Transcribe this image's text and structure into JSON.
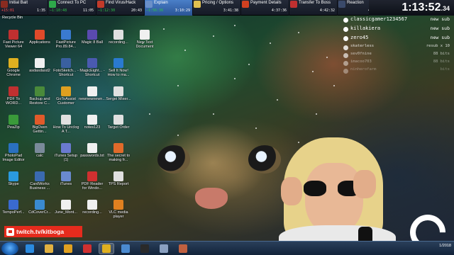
{
  "splits": [
    {
      "name": "Initial Bait",
      "delta": "+15:01",
      "delta_color": "#ff4d4d",
      "time": "1:35",
      "icon_color": "#8a2b20"
    },
    {
      "name": "Connect To PC",
      "delta": "—1:10:48",
      "delta_color": "#2ec24a",
      "time": "11:05",
      "icon_color": "#2ea84a"
    },
    {
      "name": "Find Virus/Hack",
      "delta": "—1:12:30",
      "delta_color": "#2ec24a",
      "time": "20:43",
      "icon_color": "#c23a2a"
    },
    {
      "name": "Explain",
      "delta": "—1:56:36",
      "delta_color": "#2ec24a",
      "time": "3:10:29",
      "icon_color": "#6a8fc8",
      "current": true
    },
    {
      "name": "Pricing / Options",
      "delta": "",
      "delta_color": "#ffffff",
      "time": "3:41:38",
      "icon_color": "#e0c050"
    },
    {
      "name": "Payment Details",
      "delta": "",
      "delta_color": "#ffffff",
      "time": "4:37:36",
      "icon_color": "#d04020"
    },
    {
      "name": "Transfer To Boss",
      "delta": "",
      "delta_color": "#ffffff",
      "time": "4:42:32",
      "icon_color": "#c03030"
    },
    {
      "name": "Reaction",
      "delta": "",
      "delta_color": "#ffffff",
      "time": "4:52:04",
      "icon_color": "#3a4a6a"
    }
  ],
  "timer": {
    "main": "1:13:52",
    "fraction": ".34"
  },
  "desktop": {
    "recycle_bin": "Recycle Bin",
    "icons": [
      {
        "label": "Fast Picture Viewer 64",
        "color": "#c03030"
      },
      {
        "label": "Applications",
        "color": "#e04a2a"
      },
      {
        "label": "FastPicture Pro.89.84...",
        "color": "#3a7ad0"
      },
      {
        "label": "Magic 8 Ball",
        "color": "#5a4ab0"
      },
      {
        "label": "recording...",
        "color": "#e0e0e0"
      },
      {
        "label": "New Text Document",
        "color": "#f0f0f0"
      },
      {
        "label": "Google Chrome",
        "color": "#e0b020"
      },
      {
        "label": "asdasdasd2",
        "color": "#f0f0f0"
      },
      {
        "label": "FotoSketch... - Shortcut",
        "color": "#3a60a0"
      },
      {
        "label": "MagicEight... - Shortcut",
        "color": "#4a5ab0"
      },
      {
        "label": "Sell It Now! How to ma...",
        "color": "#2a7ad0"
      },
      {
        "label": "",
        "color": "transparent"
      },
      {
        "label": "PDF To WORD...",
        "color": "#c03030"
      },
      {
        "label": "Backup and Restore C...",
        "color": "#4a8a3a"
      },
      {
        "label": "GoToAssist Customer",
        "color": "#e0a020"
      },
      {
        "label": "newnewnewn...",
        "color": "#f0f0f0"
      },
      {
        "label": "Sergei Mixer...",
        "color": "#e0e0e0"
      },
      {
        "label": "",
        "color": "transparent"
      },
      {
        "label": "PeaZip",
        "color": "#3a9a3a"
      },
      {
        "label": "BigOven Gettin...",
        "color": "#e05a2a"
      },
      {
        "label": "How To Unclog A T...",
        "color": "#e0e0e0"
      },
      {
        "label": "notes123",
        "color": "#f0f0f0"
      },
      {
        "label": "Target Order",
        "color": "#e0e0e0"
      },
      {
        "label": "",
        "color": "transparent"
      },
      {
        "label": "PhotoPad Image Editor",
        "color": "#2a70c0"
      },
      {
        "label": "calc",
        "color": "#7a8a9a"
      },
      {
        "label": "iTunes Setup (1)",
        "color": "#6a7ad0"
      },
      {
        "label": "passwords.txt",
        "color": "#f0f0f0"
      },
      {
        "label": "The secret to making fr...",
        "color": "#e06a2a"
      },
      {
        "label": "",
        "color": "transparent"
      },
      {
        "label": "Skype",
        "color": "#2a9ae0"
      },
      {
        "label": "CardWorks Business ...",
        "color": "#3a6ab0"
      },
      {
        "label": "iTunes",
        "color": "#6a8ad0"
      },
      {
        "label": "PDF Reader for Windo...",
        "color": "#d03030"
      },
      {
        "label": "TPS Report",
        "color": "#e0e0e0"
      },
      {
        "label": "",
        "color": "transparent"
      },
      {
        "label": "TempoPerf...",
        "color": "#3a6ad0"
      },
      {
        "label": "CdCoverCr...",
        "color": "#3a8ad0"
      },
      {
        "label": "June_Mont...",
        "color": "#f0f0f0"
      },
      {
        "label": "recording...",
        "color": "#f0f0f0"
      },
      {
        "label": "VLC media player",
        "color": "#e08020"
      }
    ]
  },
  "chat": [
    {
      "user": "classicgamer1234567",
      "event": "new sub"
    },
    {
      "user": "killakiera",
      "event": "new sub"
    },
    {
      "user": "zero45",
      "event": "new sub"
    },
    {
      "user": "skaterless",
      "event": "resub x 10",
      "small": true
    },
    {
      "user": "sev0fnine",
      "event": "88 bits",
      "small": true
    },
    {
      "user": "imacoo703",
      "event": "88 bits",
      "small": true
    },
    {
      "user": "ninherofarm",
      "event": "bits",
      "small": true
    }
  ],
  "twitch": {
    "handle": "twitch.tv/kitboga"
  },
  "memometer": {
    "label": "memometer"
  },
  "taskbar": {
    "clock": "1/2018",
    "items": [
      {
        "name": "internet-explorer",
        "color": "#2a8ae0"
      },
      {
        "name": "file-explorer",
        "color": "#e0b040"
      },
      {
        "name": "media-player",
        "color": "#e0a020"
      },
      {
        "name": "youtube-app",
        "color": "#d03030"
      },
      {
        "name": "chrome",
        "color": "#e0b020"
      },
      {
        "name": "quicktime",
        "color": "#4a8ad0"
      },
      {
        "name": "dell-app",
        "color": "#2a2a2a"
      },
      {
        "name": "notepad",
        "color": "#8aa0c0"
      },
      {
        "name": "paint",
        "color": "#c06040"
      }
    ]
  },
  "colors": {
    "split_current": "#3d6db5",
    "chat_text": "#ffffff",
    "twitch_red": "#e62b1d"
  }
}
